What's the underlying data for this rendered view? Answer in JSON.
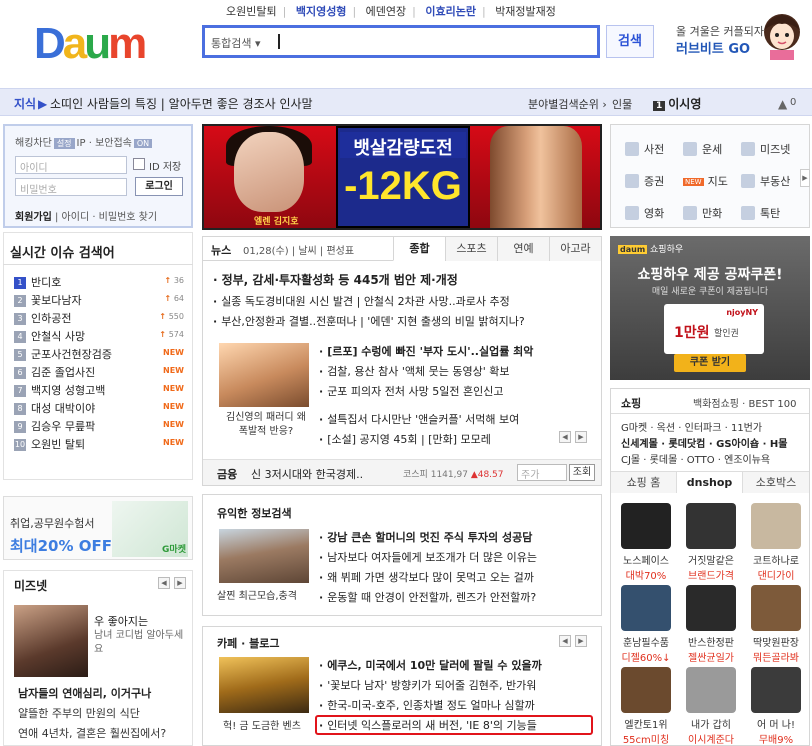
{
  "header": {
    "logo": [
      "D",
      "a",
      "u",
      "m"
    ],
    "top_keywords": [
      "오원빈탈퇴",
      "백지영성형",
      "에덴연장",
      "이효리논란",
      "박재정발재정"
    ],
    "search_category": "통합검색",
    "search_button": "검색",
    "ad_line1": "올 겨울은 커플되자!",
    "ad_line2": "러브비트 GO"
  },
  "navbar": {
    "label": "지식",
    "text": "소띠인 사람들의 특징 | 알아두면 좋은 경조사 인사말",
    "rank_label": "분야별검색순위",
    "person_label": "인물",
    "person_rank": "1",
    "person_name": "이시영",
    "count": "0"
  },
  "login": {
    "line1_a": "해킹차단",
    "line1_badge": "설정",
    "line1_b": "IP · 보안접속",
    "line1_badge2": "ON",
    "id_placeholder": "아이디",
    "pw_placeholder": "비밀번호",
    "id_save": "ID 저장",
    "login_button": "로그인",
    "join": "회원가입",
    "find": "아이디 · 비밀번호 찾기"
  },
  "issues": {
    "title": "실시간 이슈 검색어",
    "items": [
      {
        "rank": "1",
        "text": "반디호",
        "change": "36",
        "type": "up"
      },
      {
        "rank": "2",
        "text": "꽃보다남자",
        "change": "64",
        "type": "up"
      },
      {
        "rank": "3",
        "text": "인하공전",
        "change": "550",
        "type": "up"
      },
      {
        "rank": "4",
        "text": "안철식 사망",
        "change": "574",
        "type": "up"
      },
      {
        "rank": "5",
        "text": "군포사건현장검증",
        "change": "NEW",
        "type": "new"
      },
      {
        "rank": "6",
        "text": "김준 졸업사진",
        "change": "NEW",
        "type": "new"
      },
      {
        "rank": "7",
        "text": "백지영 성형고백",
        "change": "NEW",
        "type": "new"
      },
      {
        "rank": "8",
        "text": "대성 대박이야",
        "change": "NEW",
        "type": "new"
      },
      {
        "rank": "9",
        "text": "김승우 무릎팍",
        "change": "NEW",
        "type": "new"
      },
      {
        "rank": "10",
        "text": "오원빈 탈퇴",
        "change": "NEW",
        "type": "new"
      }
    ]
  },
  "leftad": {
    "line1": "취업,공무원수험서",
    "line2": "최대20% OFF"
  },
  "miznet": {
    "title": "미즈넷",
    "caption1": "우 좋아지는",
    "caption2": "남녀 코디법 알아두세요",
    "items": [
      "남자들의 연애심리, 이거구나",
      "얄뜰한 주부의 만원의 식단",
      "연애 4년차, 결혼은 훨씬집에서?"
    ]
  },
  "banner": {
    "line1": "뱃살감량도전",
    "line2": "-12KG",
    "caption": "엘렌 김지호"
  },
  "news": {
    "title": "뉴스",
    "date": "01,28(수) | 날씨 | 편성표",
    "tabs": [
      "종합",
      "스포츠",
      "연예",
      "아고라"
    ],
    "headlines": [
      "정부, 감세·투자활성화 등 445개 법안 제·개정",
      "실종 독도경비대원 시신 발견 | 안철식 2차관 사망..과로사 추정",
      "부산,안정환과 결별..전훈떠나 | '에덴' 지현 출생의 비밀 밝혀지나?"
    ],
    "photo_caption": "김신영의 패러디 왜 폭발적 반응?",
    "side_items": [
      "[르포] 수렁에 빠진 '부자 도시'..실업률 최악",
      "검찰, 용산 참사 '액체 뭇는 동영상' 확보",
      "군포 피의자 전처 사망 5일전 혼인신고",
      "설특집서 다시만난 '앤슬커플' 서먹해 보여",
      "[소설] 공지영 45회 | [만화] 모모레"
    ],
    "finance_label": "금융",
    "finance_text": "신 3저시대와 한국경제..",
    "kospi_label": "코스피",
    "kospi_value": "1141,97",
    "kospi_change": "▲48.57",
    "stock_placeholder": "주가",
    "stock_button": "조회"
  },
  "info": {
    "title": "유익한 정보검색",
    "photo_caption": "살찐 최근모습,충격",
    "items": [
      "강남 큰손 할머니의 멋진 주식 투자의 성공담",
      "남자보다 여자들에게 보조개가 더 많은 이유는",
      "왜 뷔페 가면 생각보다 많이 못먹고 오는 걸까",
      "운동할 때 안경이 안전할까, 렌즈가 안전할까?"
    ]
  },
  "cafe": {
    "title": "카페 · 블로그",
    "photo_caption": "헉! 금 도금한 벤츠",
    "items": [
      "에쿠스, 미국에서 10만 달러에 팔릴 수 있을까",
      "'꽃보다 남자' 방향키가 되어줄 김현주, 반가워",
      "한국-미국-호주, 인종차별 정도 얼마나 심할까",
      "인터넷 익스플로러의 새 버전, 'IE 8'의 기능들"
    ]
  },
  "services": [
    {
      "label": "사전",
      "icon": "dictionary-icon",
      "new": false
    },
    {
      "label": "운세",
      "icon": "fortune-icon",
      "new": false
    },
    {
      "label": "미즈넷",
      "icon": "miznet-icon",
      "new": false
    },
    {
      "label": "증권",
      "icon": "stock-icon",
      "new": false
    },
    {
      "label": "지도",
      "icon": "map-icon",
      "new": true
    },
    {
      "label": "부동산",
      "icon": "realestate-icon",
      "new": false
    },
    {
      "label": "영화",
      "icon": "movie-icon",
      "new": false
    },
    {
      "label": "만화",
      "icon": "comic-icon",
      "new": false
    },
    {
      "label": "톡탄",
      "icon": "star-icon",
      "new": false
    }
  ],
  "new_badge": "NEW",
  "shopad": {
    "logo": "쇼핑하우",
    "title": "쇼핑하우 제공 공짜쿠폰!",
    "subtitle": "매일 새로운 쿠폰이 제공됩니다",
    "brand": "njoyNY",
    "amount": "1만원",
    "coupon_label": "할인권",
    "button": "쿠폰 받기"
  },
  "shop": {
    "title": "쇼핑",
    "links": "백화점쇼핑 · BEST 100",
    "line1": "G마켓 · 옥션 · 인터파크 · 11번가",
    "line2": "신세계몰 · 롯데닷컴 · GS아이숍 · H몰",
    "line3": "CJ몰 · 롯데몰 · OTTO · 엔조이뉴욕",
    "tabs": [
      "쇼핑 홈",
      "dnshop",
      "소호박스"
    ],
    "products": [
      {
        "name": "노스페이스",
        "price": "대박70%"
      },
      {
        "name": "거짓말같은",
        "price": "브랜드가격"
      },
      {
        "name": "코트하나로",
        "price": "댄디가이"
      },
      {
        "name": "훈남필수품",
        "price": "디젤60%↓"
      },
      {
        "name": "반스한정판",
        "price": "젤싼균일가"
      },
      {
        "name": "딱맞원판장",
        "price": "뭐든골라봐"
      },
      {
        "name": "엘칸토1위",
        "price": "55cm미칭"
      },
      {
        "name": "내가 갑히",
        "price": "이시계준다"
      },
      {
        "name": "어 머 나!",
        "price": "무배9%"
      }
    ]
  }
}
